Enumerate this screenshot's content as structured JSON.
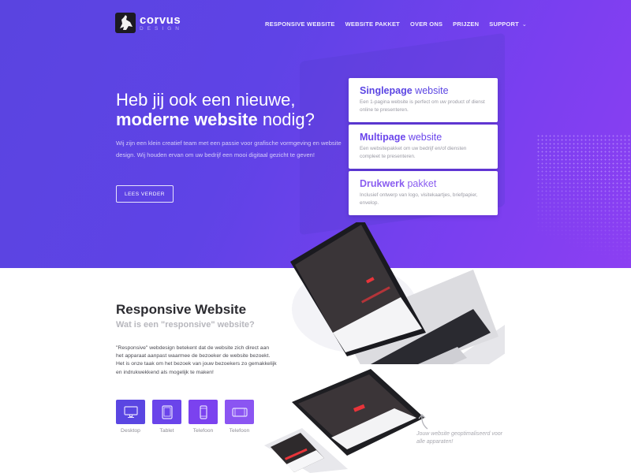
{
  "brand": {
    "name": "corvus",
    "subtitle": "DESIGN",
    "logo_icon": "raven-icon"
  },
  "colors": {
    "hero_start": "#5a44e0",
    "hero_end": "#8c3ff2",
    "accent": "#5b45e3",
    "card_title_1": "#5b45e3",
    "card_title_2": "#6a44eb",
    "card_title_3": "#8a5df0",
    "tile_1": "#5a46e2",
    "tile_2": "#6a44ea",
    "tile_3": "#7b42ef",
    "tile_4": "#8b55f2",
    "mockup_accent": "#e8343a"
  },
  "nav": {
    "items": [
      {
        "label": "RESPONSIVE WEBSITE"
      },
      {
        "label": "WEBSITE PAKKET"
      },
      {
        "label": "OVER ONS"
      },
      {
        "label": "PRIJZEN"
      },
      {
        "label": "SUPPORT",
        "icon": "chevron-down-icon",
        "chevron": "⌄"
      }
    ]
  },
  "hero": {
    "title_line1": "Heb jij ook een nieuwe,",
    "title_bold": "moderne website",
    "title_rest": " nodig?",
    "text": "Wij zijn een klein creatief team met een passie voor grafische vormgeving en website design. Wij houden ervan om uw bedrijf een mooi digitaal gezicht te geven!",
    "button_label": "LEES VERDER"
  },
  "cards": [
    {
      "title_bold": "Singlepage",
      "title_rest": " website",
      "desc": "Een 1-pagina website is perfect om uw product of dienst online te presenteren."
    },
    {
      "title_bold": "Multipage",
      "title_rest": " website",
      "desc": "Een websitepakket om uw bedrijf en/of diensten compleet te presenteren."
    },
    {
      "title_bold": "Drukwerk",
      "title_rest": " pakket",
      "desc": "Inclusief ontwerp van logo, visitekaartjes, briefpapier, envelop."
    }
  ],
  "responsive": {
    "title": "Responsive Website",
    "subtitle": "Wat is een \"responsive\" website?",
    "text": "\"Responsive\" webdesign betekent dat de website zich direct aan het apparaat aanpast waarmee de bezoeker de website bezoekt. Het is onze taak om het bezoek van jouw bezoekers zo gemakkelijk en indrukwekkend als mogelijk te maken!",
    "devices": [
      {
        "label": "Desktop",
        "icon": "desktop-icon"
      },
      {
        "label": "Tablet",
        "icon": "tablet-icon"
      },
      {
        "label": "Telefoon",
        "icon": "phone-icon"
      },
      {
        "label": "Telefoon",
        "icon": "phone-landscape-icon"
      }
    ],
    "note": "Jouw website geoptimaliseerd voor alle apparaten!"
  }
}
